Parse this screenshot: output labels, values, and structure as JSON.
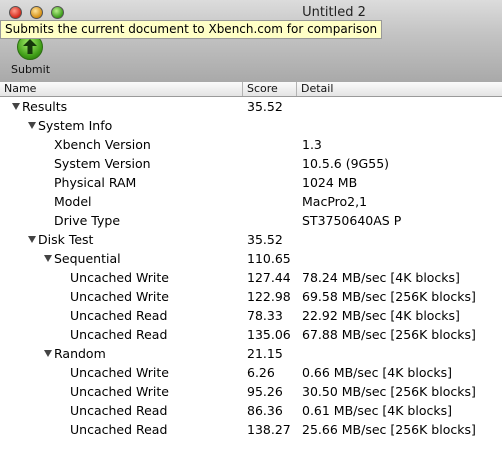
{
  "window": {
    "title": "Untitled 2"
  },
  "toolbar": {
    "submit_label": "Submit",
    "tooltip": "Submits the current document to Xbench.com for comparison"
  },
  "columns": {
    "name": "Name",
    "score": "Score",
    "detail": "Detail"
  },
  "rows": [
    {
      "name": "Results",
      "score": "35.52",
      "detail": "",
      "level": 0,
      "expandable": true
    },
    {
      "name": "System Info",
      "score": "",
      "detail": "",
      "level": 1,
      "expandable": true
    },
    {
      "name": "Xbench Version",
      "score": "",
      "detail": "1.3",
      "level": 2,
      "expandable": false
    },
    {
      "name": "System Version",
      "score": "",
      "detail": "10.5.6 (9G55)",
      "level": 2,
      "expandable": false
    },
    {
      "name": "Physical RAM",
      "score": "",
      "detail": "1024 MB",
      "level": 2,
      "expandable": false
    },
    {
      "name": "Model",
      "score": "",
      "detail": "MacPro2,1",
      "level": 2,
      "expandable": false
    },
    {
      "name": "Drive Type",
      "score": "",
      "detail": "ST3750640AS P",
      "level": 2,
      "expandable": false
    },
    {
      "name": "Disk Test",
      "score": "35.52",
      "detail": "",
      "level": 1,
      "expandable": true
    },
    {
      "name": "Sequential",
      "score": "110.65",
      "detail": "",
      "level": 2,
      "expandable": true
    },
    {
      "name": "Uncached Write",
      "score": "127.44",
      "detail": "78.24 MB/sec [4K blocks]",
      "level": 3,
      "expandable": false
    },
    {
      "name": "Uncached Write",
      "score": "122.98",
      "detail": "69.58 MB/sec [256K blocks]",
      "level": 3,
      "expandable": false
    },
    {
      "name": "Uncached Read",
      "score": "78.33",
      "detail": "22.92 MB/sec [4K blocks]",
      "level": 3,
      "expandable": false
    },
    {
      "name": "Uncached Read",
      "score": "135.06",
      "detail": "67.88 MB/sec [256K blocks]",
      "level": 3,
      "expandable": false
    },
    {
      "name": "Random",
      "score": "21.15",
      "detail": "",
      "level": 2,
      "expandable": true
    },
    {
      "name": "Uncached Write",
      "score": "6.26",
      "detail": "0.66 MB/sec [4K blocks]",
      "level": 3,
      "expandable": false
    },
    {
      "name": "Uncached Write",
      "score": "95.26",
      "detail": "30.50 MB/sec [256K blocks]",
      "level": 3,
      "expandable": false
    },
    {
      "name": "Uncached Read",
      "score": "86.36",
      "detail": "0.61 MB/sec [4K blocks]",
      "level": 3,
      "expandable": false
    },
    {
      "name": "Uncached Read",
      "score": "138.27",
      "detail": "25.66 MB/sec [256K blocks]",
      "level": 3,
      "expandable": false
    }
  ]
}
